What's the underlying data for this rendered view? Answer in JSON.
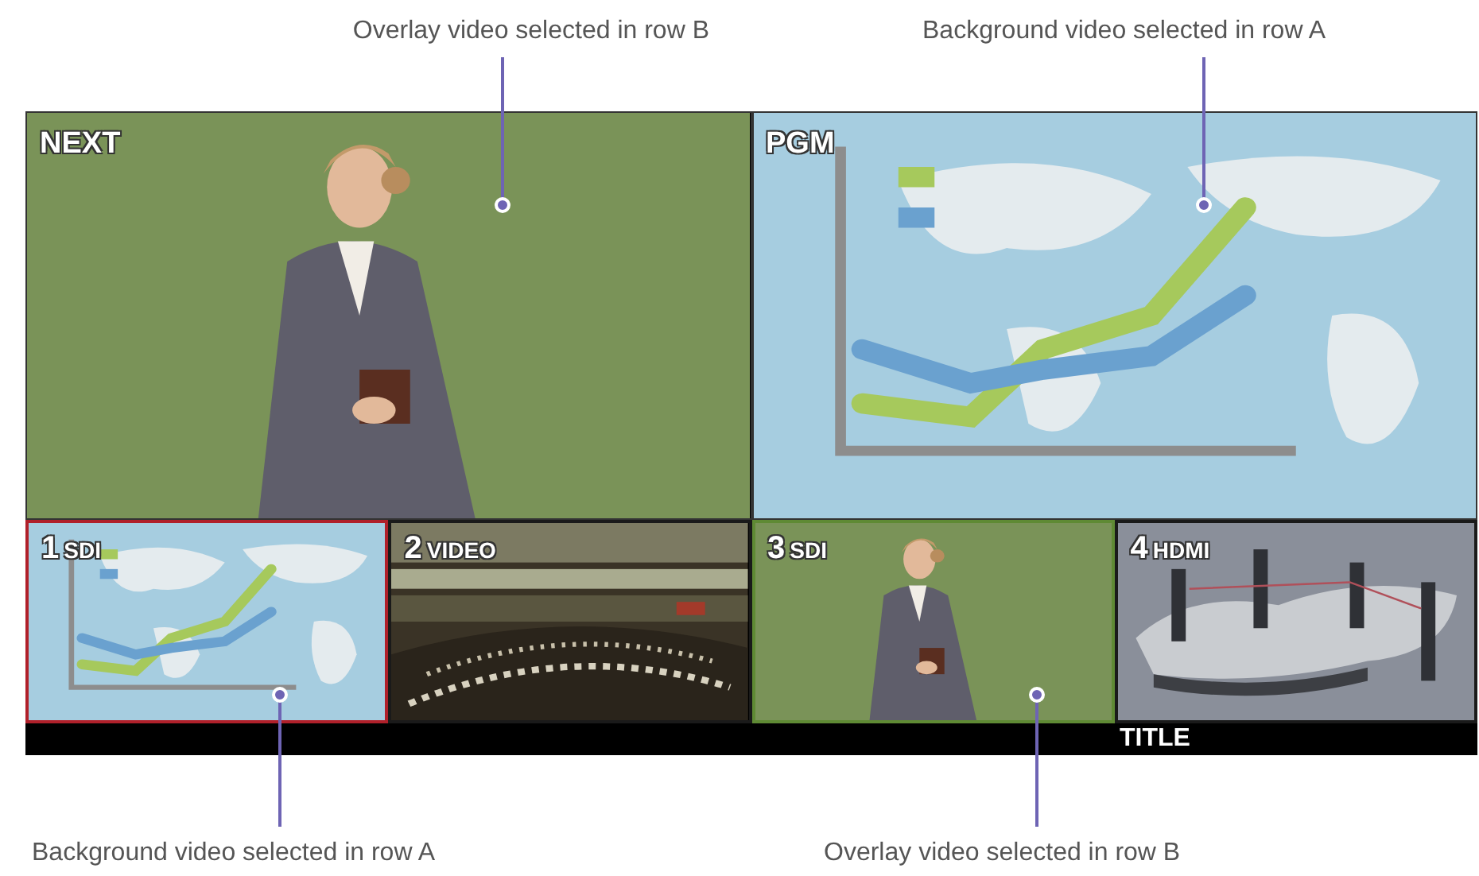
{
  "callouts_top": [
    {
      "text": "Overlay video selected in row B"
    },
    {
      "text": "Background video selected in row A"
    }
  ],
  "main_views": [
    {
      "label": "NEXT",
      "kind": "picture"
    },
    {
      "label": "PGM",
      "kind": "picture"
    }
  ],
  "inputs": [
    {
      "number": "1",
      "source": "SDI",
      "selected": true,
      "color": "#b0202a",
      "kind": "picture"
    },
    {
      "number": "2",
      "source": "VIDEO",
      "selected": false,
      "kind": "picture"
    },
    {
      "number": "3",
      "source": "SDI",
      "selected": true,
      "color": "#5f8a34",
      "kind": "picture"
    },
    {
      "number": "4",
      "source": "HDMI",
      "selected": false,
      "kind": "picture"
    }
  ],
  "title_strip": {
    "text": "TITLE"
  },
  "callouts_bottom": [
    {
      "text": "Background video selected in row A"
    },
    {
      "text": "Overlay video selected in row B"
    }
  ]
}
